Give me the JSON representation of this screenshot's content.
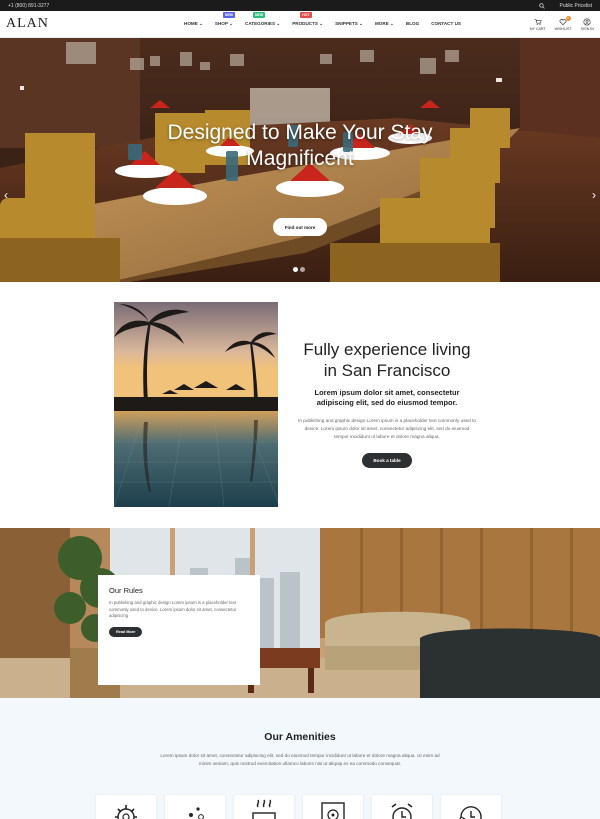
{
  "topbar": {
    "phone": "+1 (800) 891-3277",
    "account": "Public Pricelist"
  },
  "header": {
    "logo": "ALAN",
    "nav": [
      {
        "label": "HOME",
        "caret": true
      },
      {
        "label": "SHOP",
        "caret": true,
        "badge": "NEW",
        "badge_color": "#5a62e6"
      },
      {
        "label": "CATEGORIES",
        "caret": true,
        "badge": "NEW",
        "badge_color": "#2cc07c"
      },
      {
        "label": "PRODUCTS",
        "caret": true,
        "badge": "HOT",
        "badge_color": "#e84a4a"
      },
      {
        "label": "SNIPPETS",
        "caret": true
      },
      {
        "label": "MORE",
        "caret": true
      },
      {
        "label": "BLOG",
        "caret": false
      },
      {
        "label": "CONTACT US",
        "caret": false
      }
    ],
    "cart_label": "MY CART",
    "cart_count": "0",
    "wishlist_label": "WISHLIST",
    "wishlist_count": "0",
    "signin_label": "SIGN IN"
  },
  "hero": {
    "title_line1": "Designed to Make Your Stay",
    "title_line2": "Magnificent",
    "button": "Find out more",
    "slide_count": 2,
    "active_slide": 1
  },
  "about": {
    "title_line1": "Fully experience living",
    "title_line2": "in San Francisco",
    "subtitle": "Lorem ipsum dolor sit amet, consectetur adipiscing elit, sed do eiusmod tempor.",
    "body": "In publishing and graphic design Lorem ipsum is a placeholder text commonly used to device. Lorem ipsum dolor sit amet, consectetur adipiscing elit, sed do eiusmod tempor incididunt ut labore et dolore magna aliqua.",
    "button": "Book a table"
  },
  "rules": {
    "title": "Our Rules",
    "body": "In publishing and graphic design Lorem ipsum is a placeholder text commonly used to device. Lorem ipsum dolor sit amet, consectetur adipiscing",
    "button": "Read More"
  },
  "amenities": {
    "title": "Our Amenities",
    "body": "Lorem ipsum dolor sit amet, consectetur adipiscing elit, sed do eiusmod tempor incididunt ut labore et dolore magna aliqua. Ut enim ad minim veniam, quis nostrud exercitation ullamco laboris nisi ut aliquip ex ea commodo consequat.",
    "icons": [
      "gear-icon",
      "bubbles-icon",
      "hot-tub-icon",
      "safe-icon",
      "alarm-clock-icon",
      "clock-refresh-icon"
    ]
  },
  "colors": {
    "dark": "#2d3033",
    "topbar": "#1b1b1b",
    "accent": "#e78b2a"
  }
}
